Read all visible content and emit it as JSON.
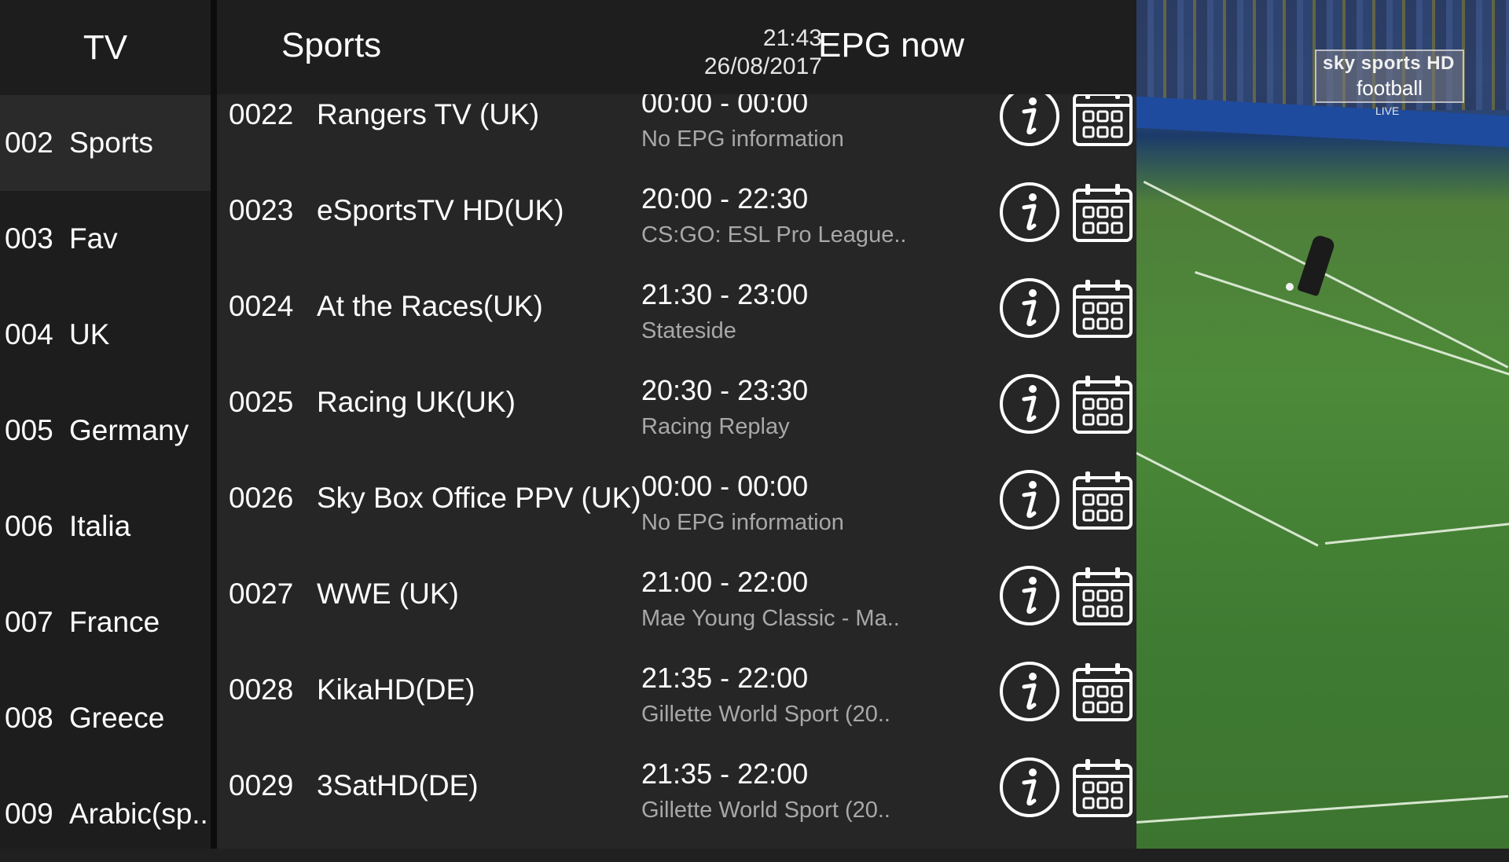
{
  "categories": {
    "header": "TV",
    "items": [
      {
        "num": "002",
        "label": "Sports",
        "selected": true
      },
      {
        "num": "003",
        "label": "Fav"
      },
      {
        "num": "004",
        "label": "UK"
      },
      {
        "num": "005",
        "label": "Germany"
      },
      {
        "num": "006",
        "label": "Italia"
      },
      {
        "num": "007",
        "label": "France"
      },
      {
        "num": "008",
        "label": "Greece"
      },
      {
        "num": "009",
        "label": "Arabic(sp.."
      }
    ]
  },
  "list": {
    "title": "Sports",
    "time": "21:43",
    "date": "26/08/2017",
    "epg_title": "EPG now",
    "channels": [
      {
        "num": "0022",
        "name": "Rangers TV (UK)",
        "time": "00:00 - 00:00",
        "program": "No EPG information"
      },
      {
        "num": "0023",
        "name": "eSportsTV HD(UK)",
        "time": "20:00 - 22:30",
        "program": "CS:GO: ESL Pro League.."
      },
      {
        "num": "0024",
        "name": "At the Races(UK)",
        "time": "21:30 - 23:00",
        "program": "Stateside"
      },
      {
        "num": "0025",
        "name": "Racing UK(UK)",
        "time": "20:30 - 23:30",
        "program": "Racing Replay"
      },
      {
        "num": "0026",
        "name": "Sky Box Office PPV (UK)",
        "time": "00:00 - 00:00",
        "program": "No EPG information"
      },
      {
        "num": "0027",
        "name": "WWE (UK)",
        "time": "21:00 - 22:00",
        "program": "Mae Young Classic - Ma.."
      },
      {
        "num": "0028",
        "name": "KikaHD(DE)",
        "time": "21:35 - 22:00",
        "program": "Gillette World Sport  (20.."
      },
      {
        "num": "0029",
        "name": "3SatHD(DE)",
        "time": "21:35 - 22:00",
        "program": "Gillette World Sport  (20.."
      }
    ],
    "info_icon": "info-icon",
    "epg_icon": "calendar-grid-icon"
  },
  "video": {
    "badge_top": "sky sports HD",
    "badge_bottom": "football",
    "badge_live": "LIVE"
  },
  "colors": {
    "background": "#262626",
    "sidebar": "#1d1d1d",
    "secondary_text": "#a8a8a8"
  }
}
